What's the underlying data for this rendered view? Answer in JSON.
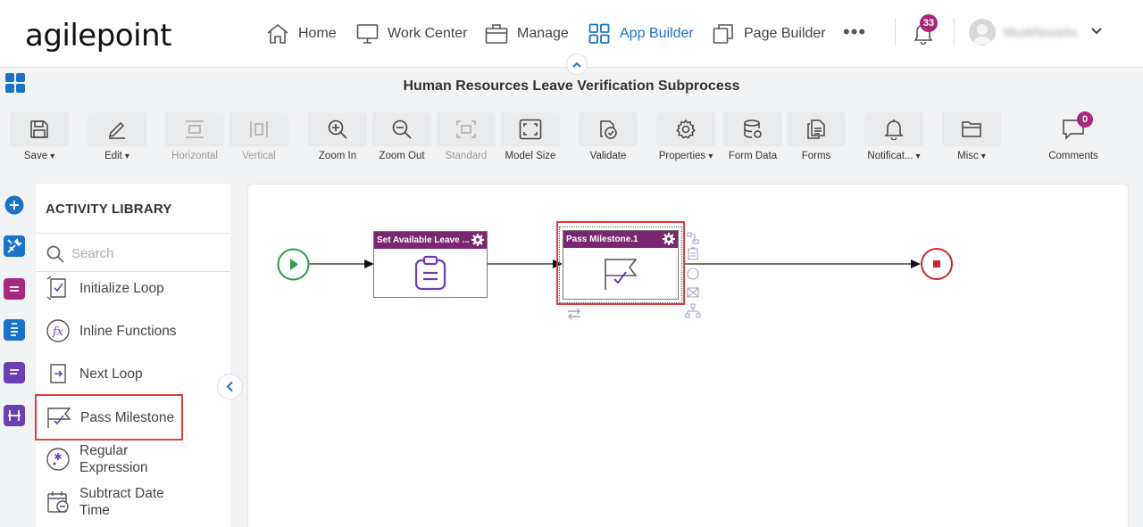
{
  "nav": {
    "logo": "agilepoint",
    "items": [
      {
        "id": "home",
        "label": "Home"
      },
      {
        "id": "work-center",
        "label": "Work Center"
      },
      {
        "id": "manage",
        "label": "Manage"
      },
      {
        "id": "app-builder",
        "label": "App Builder",
        "active": true
      },
      {
        "id": "page-builder",
        "label": "Page Builder"
      }
    ],
    "more": "•••",
    "notification_count": "33",
    "user_name": "MuskNovaAs"
  },
  "title": "Human Resources Leave Verification Subprocess",
  "toolbar": {
    "save": "Save",
    "edit": "Edit",
    "horizontal": "Horizontal",
    "vertical": "Vertical",
    "zoom_in": "Zoom In",
    "zoom_out": "Zoom Out",
    "standard": "Standard",
    "model_size": "Model Size",
    "validate": "Validate",
    "properties": "Properties",
    "form_data": "Form Data",
    "forms": "Forms",
    "notifications": "Notificat...",
    "misc": "Misc",
    "comments": "Comments",
    "comments_count": "0"
  },
  "library": {
    "title": "ACTIVITY LIBRARY",
    "search_placeholder": "Search",
    "items": [
      {
        "label": "Initialize Loop",
        "icon": "initialize-loop-icon"
      },
      {
        "label": "Inline Functions",
        "icon": "inline-functions-icon"
      },
      {
        "label": "Next Loop",
        "icon": "next-loop-icon"
      },
      {
        "label": "Pass Milestone",
        "icon": "pass-milestone-icon"
      },
      {
        "label": "Regular Expression",
        "icon": "regex-icon"
      },
      {
        "label": "Subtract Date Time",
        "icon": "subtract-date-icon"
      }
    ]
  },
  "canvas": {
    "activity1": "Set Available Leave ...",
    "activity2": "Pass Milestone.1"
  },
  "colors": {
    "accent": "#1a73c8",
    "activity_header": "#7c2673",
    "start": "#2e9a48",
    "end": "#c8282d",
    "highlight": "#e03c3c"
  }
}
